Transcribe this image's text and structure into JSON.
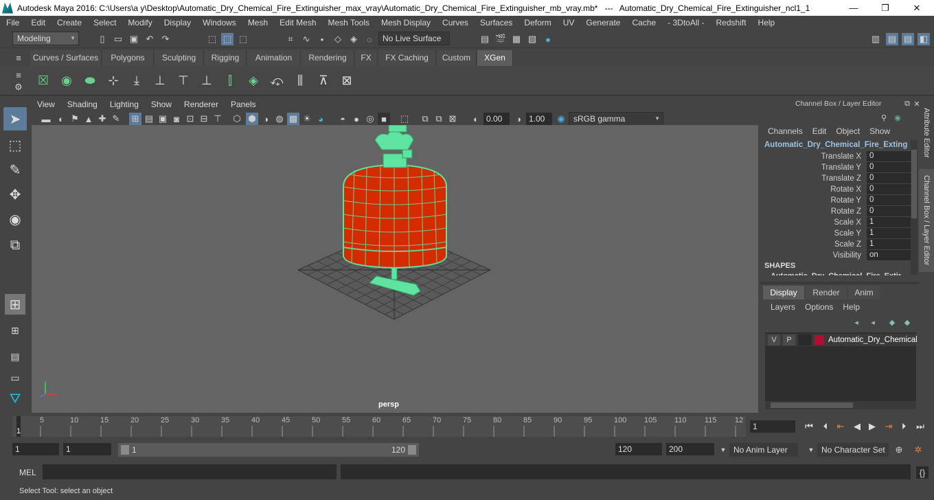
{
  "window": {
    "title": "Autodesk Maya 2016: C:\\Users\\a y\\Desktop\\Automatic_Dry_Chemical_Fire_Extinguisher_max_vray\\Automatic_Dry_Chemical_Fire_Extinguisher_mb_vray.mb*   ---   Automatic_Dry_Chemical_Fire_Extinguisher_ncl1_1",
    "minimize": "—",
    "maximize": "❐",
    "close": "✕"
  },
  "menubar": [
    "File",
    "Edit",
    "Create",
    "Select",
    "Modify",
    "Display",
    "Windows",
    "Mesh",
    "Edit Mesh",
    "Mesh Tools",
    "Mesh Display",
    "Curves",
    "Surfaces",
    "Deform",
    "UV",
    "Generate",
    "Cache",
    "- 3DtoAll -",
    "Redshift",
    "Help"
  ],
  "statusline": {
    "mode": "Modeling",
    "live_surface": "No Live Surface"
  },
  "shelf_tabs": [
    "Curves / Surfaces",
    "Polygons",
    "Sculpting",
    "Rigging",
    "Animation",
    "Rendering",
    "FX",
    "FX Caching",
    "Custom",
    "XGen"
  ],
  "active_shelf_tab": "XGen",
  "panel_menu": [
    "View",
    "Shading",
    "Lighting",
    "Show",
    "Renderer",
    "Panels"
  ],
  "panel_toolbar": {
    "exposure": "0.00",
    "gamma": "1.00",
    "color_space": "sRGB gamma"
  },
  "viewport": {
    "camera_label": "persp"
  },
  "channel_box": {
    "title": "Channel Box / Layer Editor",
    "menu": [
      "Channels",
      "Edit",
      "Object",
      "Show"
    ],
    "object_name": "Automatic_Dry_Chemical_Fire_Extingu...",
    "attributes": [
      {
        "label": "Translate X",
        "value": "0"
      },
      {
        "label": "Translate Y",
        "value": "0"
      },
      {
        "label": "Translate Z",
        "value": "0"
      },
      {
        "label": "Rotate X",
        "value": "0"
      },
      {
        "label": "Rotate Y",
        "value": "0"
      },
      {
        "label": "Rotate Z",
        "value": "0"
      },
      {
        "label": "Scale X",
        "value": "1"
      },
      {
        "label": "Scale Y",
        "value": "1"
      },
      {
        "label": "Scale Z",
        "value": "1"
      },
      {
        "label": "Visibility",
        "value": "on"
      }
    ],
    "shapes_header": "SHAPES",
    "shapes_item": "Automatic_Dry_Chemical_Fire_Extin...",
    "layer_tabs": [
      "Display",
      "Render",
      "Anim"
    ],
    "active_layer_tab": "Display",
    "layer_menu": [
      "Layers",
      "Options",
      "Help"
    ],
    "layer": {
      "v": "V",
      "p": "P",
      "name": "Automatic_Dry_Chemical",
      "color": "#b01030"
    }
  },
  "side_tabs": [
    "Attribute Editor",
    "Channel Box / Layer Editor"
  ],
  "timeline": {
    "ticks": [
      "5",
      "10",
      "15",
      "20",
      "25",
      "30",
      "35",
      "40",
      "45",
      "50",
      "55",
      "60",
      "65",
      "70",
      "75",
      "80",
      "85",
      "90",
      "95",
      "100",
      "105",
      "110",
      "115",
      "12"
    ],
    "current_frame_marker": "1",
    "current_frame": "1"
  },
  "range": {
    "start": "1",
    "playback_start": "1",
    "slider_start": "1",
    "slider_end": "120",
    "playback_end": "120",
    "end": "200",
    "anim_layer": "No Anim Layer",
    "character_set": "No Character Set"
  },
  "cmdline": {
    "label": "MEL"
  },
  "helpline": {
    "text": "Select Tool: select an object"
  },
  "colors": {
    "wireframe": "#5fe3a1",
    "body": "#d42c00",
    "viewport_bg": "#646464"
  }
}
